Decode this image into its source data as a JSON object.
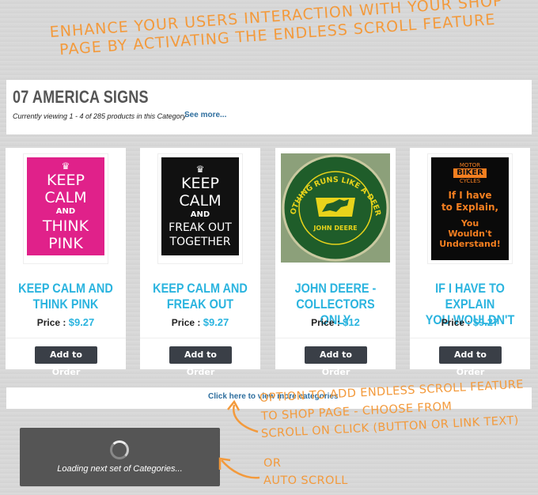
{
  "promo_note": {
    "line1": "ENHANCE YOUR USERS INTERACTION WITH YOUR SHOP",
    "line2": "PAGE BY ACTIVATING THE ENDLESS SCROLL FEATURE"
  },
  "category": {
    "title": "07 AMERICA SIGNS",
    "subtitle": "Currently viewing 1 - 4 of 285 products in this Category",
    "see_more": "See more..."
  },
  "products": [
    {
      "title_line1": "KEEP CALM AND",
      "title_line2": "THINK PINK",
      "price_label": "Price :",
      "price": "$9.27",
      "button": "Add to Order",
      "sign": {
        "crown": "♛",
        "l1": "KEEP",
        "l2": "CALM",
        "l3": "AND",
        "l4": "THINK",
        "l5": "PINK"
      }
    },
    {
      "title_line1": "KEEP CALM AND",
      "title_line2": "FREAK OUT",
      "price_label": "Price :",
      "price": "$9.27",
      "button": "Add to Order",
      "sign": {
        "crown": "♛",
        "l1": "KEEP",
        "l2": "CALM",
        "l3": "AND",
        "l4": "FREAK OUT",
        "l5": "TOGETHER"
      }
    },
    {
      "title_line1": "JOHN DEERE -",
      "title_line2": "COLLECTORS ONLY",
      "price_label": "Price :",
      "price": "$12",
      "button": "Add to Order",
      "sign": {
        "arc": "NOTHING RUNS LIKE A DEERE",
        "brand": "JOHN DEERE"
      }
    },
    {
      "title_line1": "IF I HAVE TO EXPLAIN",
      "title_line2": "YOU WOULDN'T",
      "price_label": "Price :",
      "price": "$9.27",
      "button": "Add to Order",
      "sign": {
        "top": "MOTOR",
        "brand": "BIKER",
        "sub": "CYCLES",
        "l1": "If I have",
        "l2": "to Explain,",
        "l3": "You",
        "l4": "Wouldn't",
        "l5": "Understand!"
      }
    }
  ],
  "more_categories_link": "Click here to view more categories",
  "loading_text": "Loading next set of Categories...",
  "option_note": {
    "line1": "OPTION TO ADD ENDLESS SCROLL FEATURE",
    "line2": "TO SHOP PAGE - CHOOSE FROM",
    "line3": "SCROLL ON CLICK (BUTTON OR LINK TEXT)",
    "line4": "OR",
    "line5": "AUTO SCROLL"
  },
  "colors": {
    "accent": "#2bb4df",
    "annotation": "#f39a3c",
    "button": "#3a3f47",
    "link": "#2e6e9e"
  }
}
